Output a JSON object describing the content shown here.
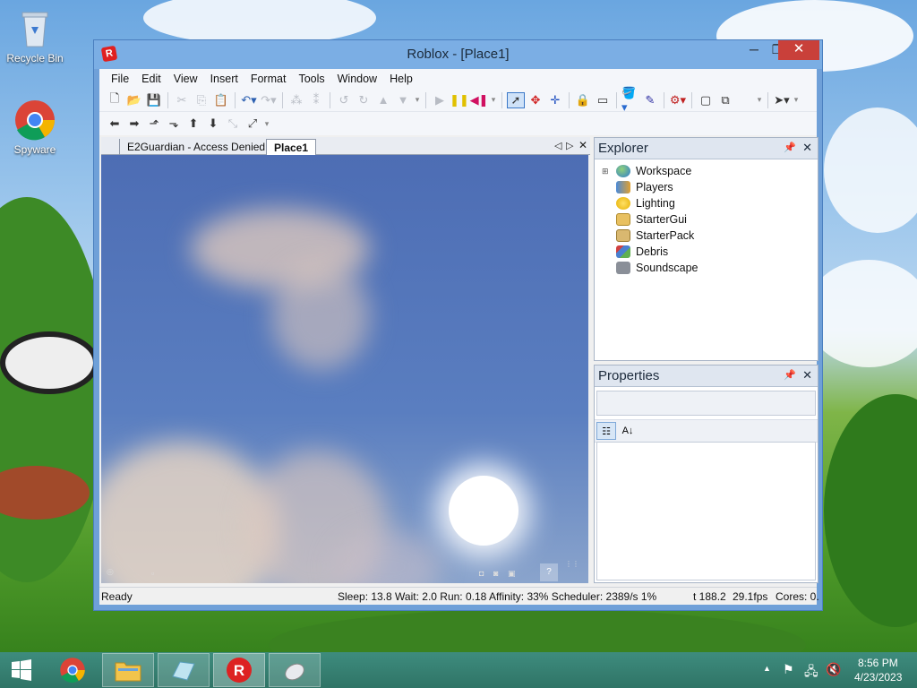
{
  "desktop": {
    "icons": [
      {
        "label": "Recycle Bin",
        "icon": "recycle-bin-icon"
      },
      {
        "label": "Spyware",
        "icon": "chrome-icon"
      }
    ]
  },
  "window": {
    "title": "Roblox - [Place1]",
    "app_icon": "roblox-icon",
    "minimize": "─",
    "maximize": "❐",
    "close": "✕"
  },
  "menu": [
    "File",
    "Edit",
    "View",
    "Insert",
    "Format",
    "Tools",
    "Window",
    "Help"
  ],
  "tabs": [
    {
      "label": "E2Guardian - Access Denied",
      "active": false
    },
    {
      "label": "Place1",
      "active": true
    }
  ],
  "explorer": {
    "title": "Explorer",
    "items": [
      {
        "label": "Workspace",
        "icon": "globe-icon",
        "expandable": true
      },
      {
        "label": "Players",
        "icon": "players-icon",
        "expandable": false
      },
      {
        "label": "Lighting",
        "icon": "lightbulb-icon",
        "expandable": false
      },
      {
        "label": "StarterGui",
        "icon": "folder-icon",
        "expandable": false
      },
      {
        "label": "StarterPack",
        "icon": "backpack-icon",
        "expandable": false
      },
      {
        "label": "Debris",
        "icon": "debris-icon",
        "expandable": false
      },
      {
        "label": "Soundscape",
        "icon": "speaker-icon",
        "expandable": false
      }
    ]
  },
  "properties": {
    "title": "Properties"
  },
  "statusbar": {
    "left": "Ready",
    "stats": "Sleep: 13.8 Wait: 2.0 Run: 0.18 Affinity: 33% Scheduler: 2389/s 1%",
    "time": "t 188.2",
    "fps": "29.1fps",
    "cores": "Cores: 0."
  },
  "taskbar": {
    "clock_time": "8:56 PM",
    "clock_date": "4/23/2023"
  },
  "colors": {
    "close_button": "#c9403a",
    "taskbar": "#2f7466",
    "viewport_sky": "#4d6db4"
  }
}
